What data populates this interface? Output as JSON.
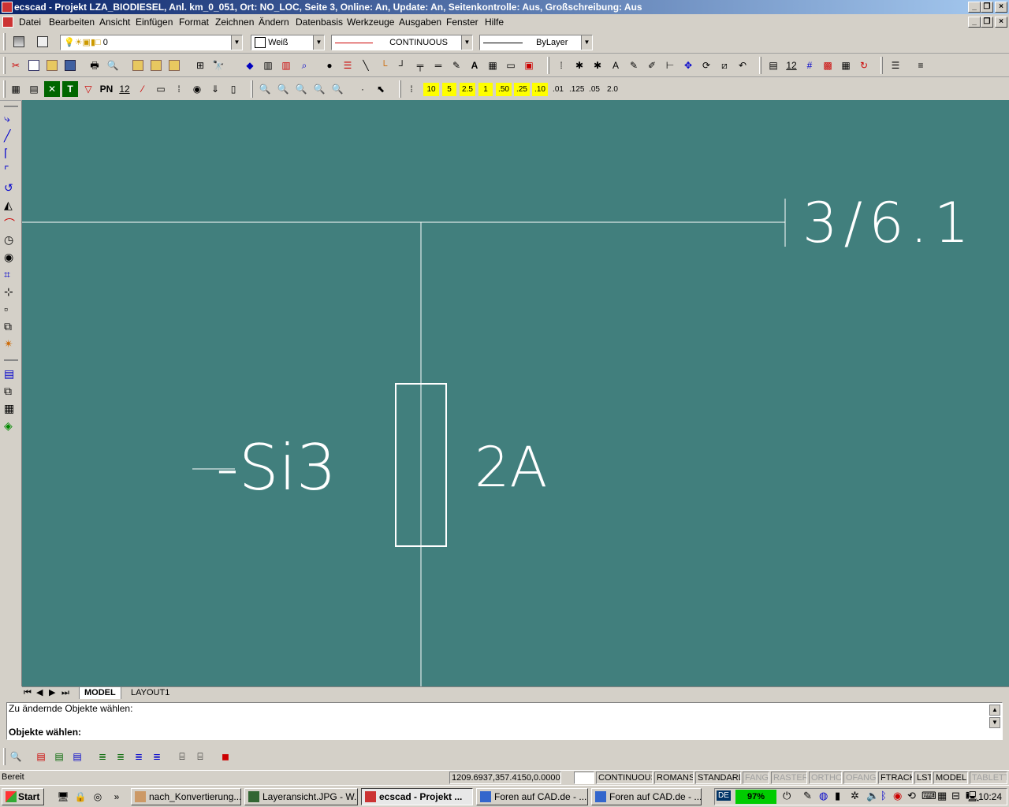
{
  "window": {
    "title": "ecscad  - Projekt LZA_BIODIESEL,  Anl. km_0_051,  Ort: NO_LOC,  Seite 3,  Online: An,  Update: An,  Seitenkontrolle: Aus,  Großschreibung: Aus"
  },
  "menu": [
    "Datei",
    "Bearbeiten",
    "Ansicht",
    "Einfügen",
    "Format",
    "Zeichnen",
    "Ändern",
    "Datenbasis",
    "Werkzeuge",
    "Ausgaben",
    "Fenster",
    "Hilfe"
  ],
  "props": {
    "layer": "0",
    "color": "Weiß",
    "linetype": "CONTINUOUS",
    "lineweight": "ByLayer"
  },
  "toolbar3": {
    "pn_label": "PN",
    "num_label": "12",
    "scales": [
      "10",
      "5",
      "2.5",
      "1",
      ".50",
      ".25",
      ".10",
      ".01",
      ".125",
      ".05",
      "2.0"
    ]
  },
  "toolbar2": {
    "text_tool": "A",
    "num12": "12"
  },
  "drawing": {
    "reference": "3/6.1",
    "device_tag": "-Si3",
    "rating": "2A",
    "background": "#417f7d",
    "line_color": "#ffffff"
  },
  "tabs": [
    "MODEL",
    "LAYOUT1"
  ],
  "command": {
    "line1": "Zu ändernde Objekte wählen:",
    "line2": "Objekte wählen:"
  },
  "status": {
    "ready": "Bereit",
    "coords": "1209.6937,357.4150,0.0000",
    "linetype": "CONTINUOUS",
    "font": "ROMANS",
    "style": "STANDARD",
    "toggles": [
      {
        "label": "FANG",
        "on": false
      },
      {
        "label": "RASTER",
        "on": false
      },
      {
        "label": "ORTHO",
        "on": false
      },
      {
        "label": "OFANG",
        "on": false
      },
      {
        "label": "FTRACK",
        "on": true
      },
      {
        "label": "LST",
        "on": true
      },
      {
        "label": "MODELL",
        "on": true
      },
      {
        "label": "TABLETT",
        "on": false
      }
    ]
  },
  "taskbar": {
    "start": "Start",
    "more": "»",
    "tasks": [
      {
        "label": "nach_Konvertierung....",
        "active": false
      },
      {
        "label": "Layeransicht.JPG - W...",
        "active": false
      },
      {
        "label": "ecscad  - Projekt ...",
        "active": true
      },
      {
        "label": "Foren auf CAD.de - ...",
        "active": false
      },
      {
        "label": "Foren auf CAD.de - ...",
        "active": false
      }
    ],
    "lang": "DE",
    "battery": "97%",
    "clock": "10:24"
  }
}
